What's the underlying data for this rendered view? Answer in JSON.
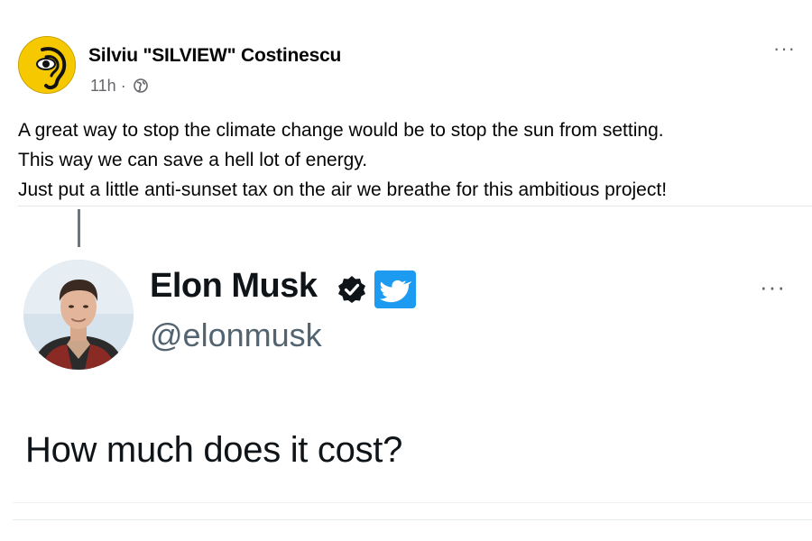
{
  "facebook_post": {
    "author": "Silviu \"SILVIEW\" Costinescu",
    "time": "11h",
    "separator": "·",
    "avatar_icon": "ear-logo-icon",
    "privacy_icon": "globe-icon",
    "more_label": "···",
    "text_lines": [
      "A great way to stop the climate change would be to stop the sun from setting.",
      "This way we can save a hell lot of energy.",
      "Just put a little anti-sunset tax on the air we breathe for this ambitious project!"
    ]
  },
  "tweet": {
    "name": "Elon Musk",
    "handle": "@elonmusk",
    "text": "How much does it cost?",
    "more_label": "···",
    "verified_icon": "verified-badge-icon",
    "platform_icon": "twitter-logo-icon"
  },
  "colors": {
    "fb_avatar_bg": "#f6c800",
    "fb_secondary_text": "#65676b",
    "twitter_blue": "#1d9bf0",
    "tweet_secondary_text": "#536471"
  }
}
